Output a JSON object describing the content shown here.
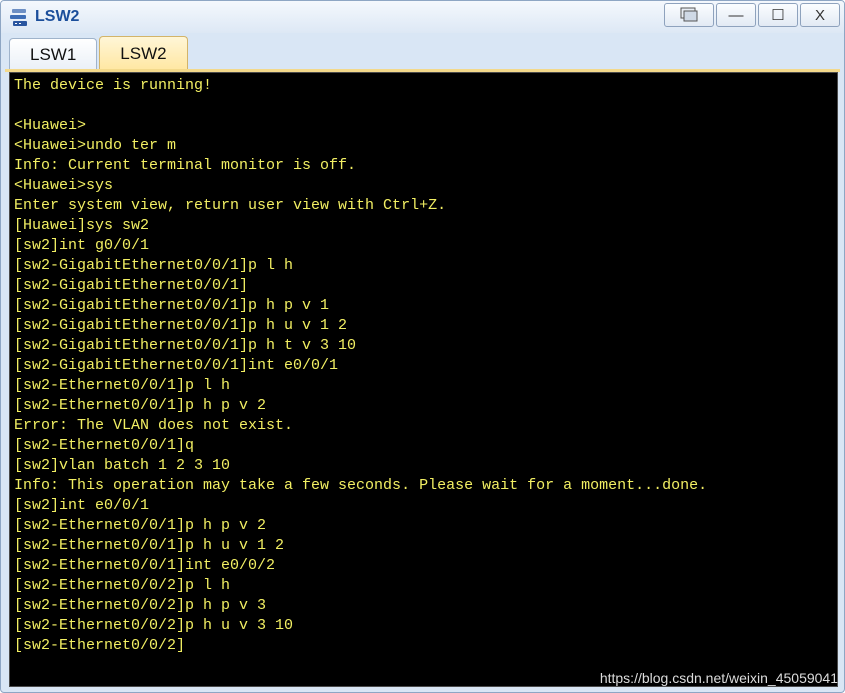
{
  "window": {
    "title": "LSW2",
    "controls": {
      "restore_icon": "restore-window-icon",
      "minimize": "—",
      "maximize": "☐",
      "close": "X"
    }
  },
  "tabs": [
    {
      "label": "LSW1",
      "active": false
    },
    {
      "label": "LSW2",
      "active": true
    }
  ],
  "terminal": {
    "lines": [
      "The device is running!",
      "",
      "<Huawei>",
      "<Huawei>undo ter m",
      "Info: Current terminal monitor is off.",
      "<Huawei>sys",
      "Enter system view, return user view with Ctrl+Z.",
      "[Huawei]sys sw2",
      "[sw2]int g0/0/1",
      "[sw2-GigabitEthernet0/0/1]p l h",
      "[sw2-GigabitEthernet0/0/1]",
      "[sw2-GigabitEthernet0/0/1]p h p v 1",
      "[sw2-GigabitEthernet0/0/1]p h u v 1 2",
      "[sw2-GigabitEthernet0/0/1]p h t v 3 10",
      "[sw2-GigabitEthernet0/0/1]int e0/0/1",
      "[sw2-Ethernet0/0/1]p l h",
      "[sw2-Ethernet0/0/1]p h p v 2",
      "Error: The VLAN does not exist.",
      "[sw2-Ethernet0/0/1]q",
      "[sw2]vlan batch 1 2 3 10",
      "Info: This operation may take a few seconds. Please wait for a moment...done.",
      "[sw2]int e0/0/1",
      "[sw2-Ethernet0/0/1]p h p v 2",
      "[sw2-Ethernet0/0/1]p h u v 1 2",
      "[sw2-Ethernet0/0/1]int e0/0/2",
      "[sw2-Ethernet0/0/2]p l h",
      "[sw2-Ethernet0/0/2]p h p v 3",
      "[sw2-Ethernet0/0/2]p h u v 3 10",
      "[sw2-Ethernet0/0/2]"
    ],
    "text_color": "#f2ef63",
    "background": "#000000"
  },
  "watermark": "https://blog.csdn.net/weixin_45059041"
}
